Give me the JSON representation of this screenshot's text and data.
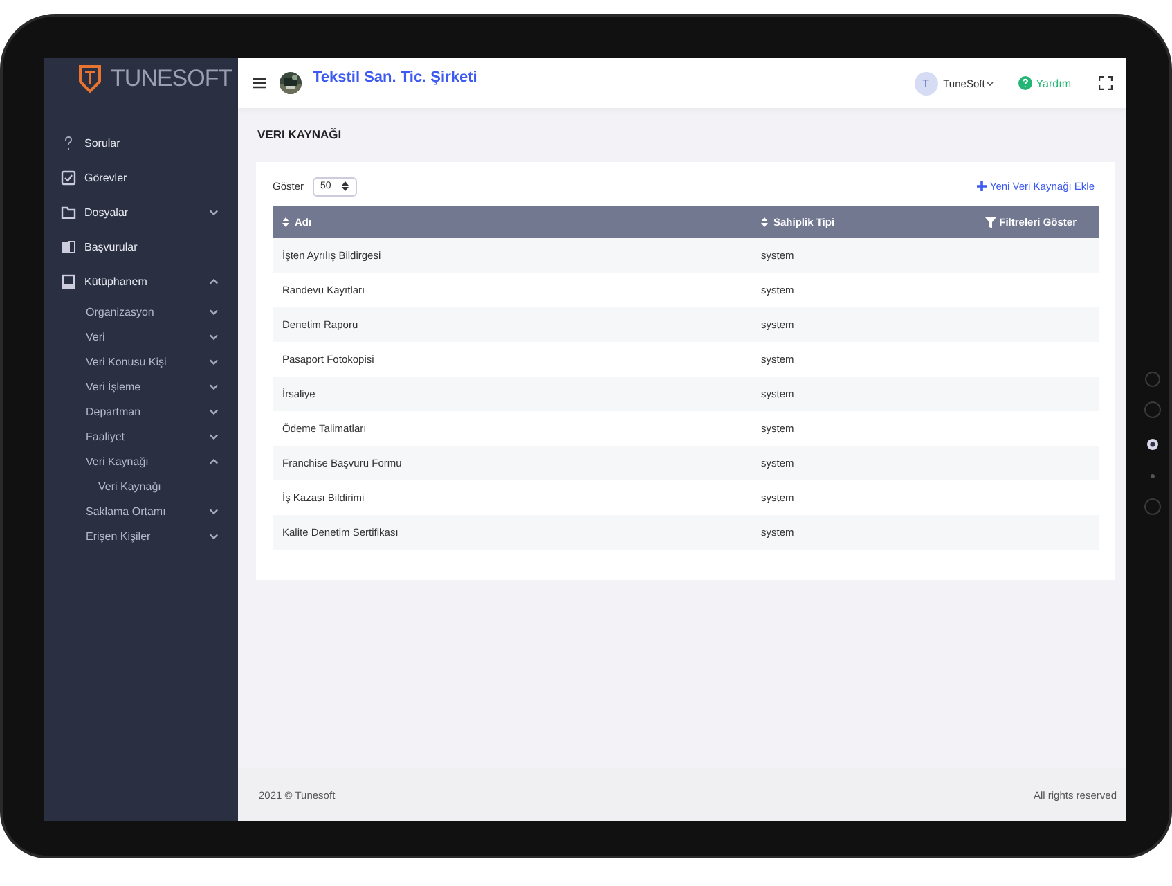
{
  "logo": {
    "text": "**TUNE**SOFT"
  },
  "sidebar": {
    "items": [
      {
        "label": "Sorular"
      },
      {
        "label": "Görevler"
      },
      {
        "label": "Dosyalar",
        "expanded": false
      },
      {
        "label": "Başvurular"
      },
      {
        "label": "Kütüphanem",
        "expanded": true,
        "children": [
          {
            "label": "Organizasyon",
            "expanded": false
          },
          {
            "label": "Veri",
            "expanded": false
          },
          {
            "label": "Veri Konusu Kişi",
            "expanded": false
          },
          {
            "label": "Veri İşleme",
            "expanded": false
          },
          {
            "label": "Departman",
            "expanded": false
          },
          {
            "label": "Faaliyet",
            "expanded": false
          },
          {
            "label": "Veri Kaynağı",
            "expanded": true,
            "children": [
              {
                "label": "Veri Kaynağı"
              }
            ]
          },
          {
            "label": "Saklama Ortamı",
            "expanded": false
          },
          {
            "label": "Erişen Kişiler",
            "expanded": false
          }
        ]
      }
    ]
  },
  "header": {
    "company": "Tekstil San. Tic. Şirketi",
    "user_initial": "T",
    "user_name": "TuneSoft",
    "help": "Yardım"
  },
  "page": {
    "title": "VERI KAYNAĞI",
    "show_label": "Göster",
    "page_size": "50",
    "add_button": "Yeni Veri Kaynağı Ekle"
  },
  "table": {
    "columns": [
      "Adı",
      "Sahiplik Tipi"
    ],
    "filter_button": "Filtreleri Göster",
    "rows": [
      [
        "İşten Ayrılış Bildirgesi",
        "system"
      ],
      [
        "Randevu Kayıtları",
        "system"
      ],
      [
        "Denetim Raporu",
        "system"
      ],
      [
        "Pasaport Fotokopisi",
        "system"
      ],
      [
        "İrsaliye",
        "system"
      ],
      [
        "Ödeme Talimatları",
        "system"
      ],
      [
        "Franchise Başvuru Formu",
        "system"
      ],
      [
        "İş Kazası Bildirimi",
        "system"
      ],
      [
        "Kalite Denetim Sertifikası",
        "system"
      ]
    ]
  },
  "footer": {
    "left": "2021 © Tunesoft",
    "right": "All rights reserved"
  }
}
